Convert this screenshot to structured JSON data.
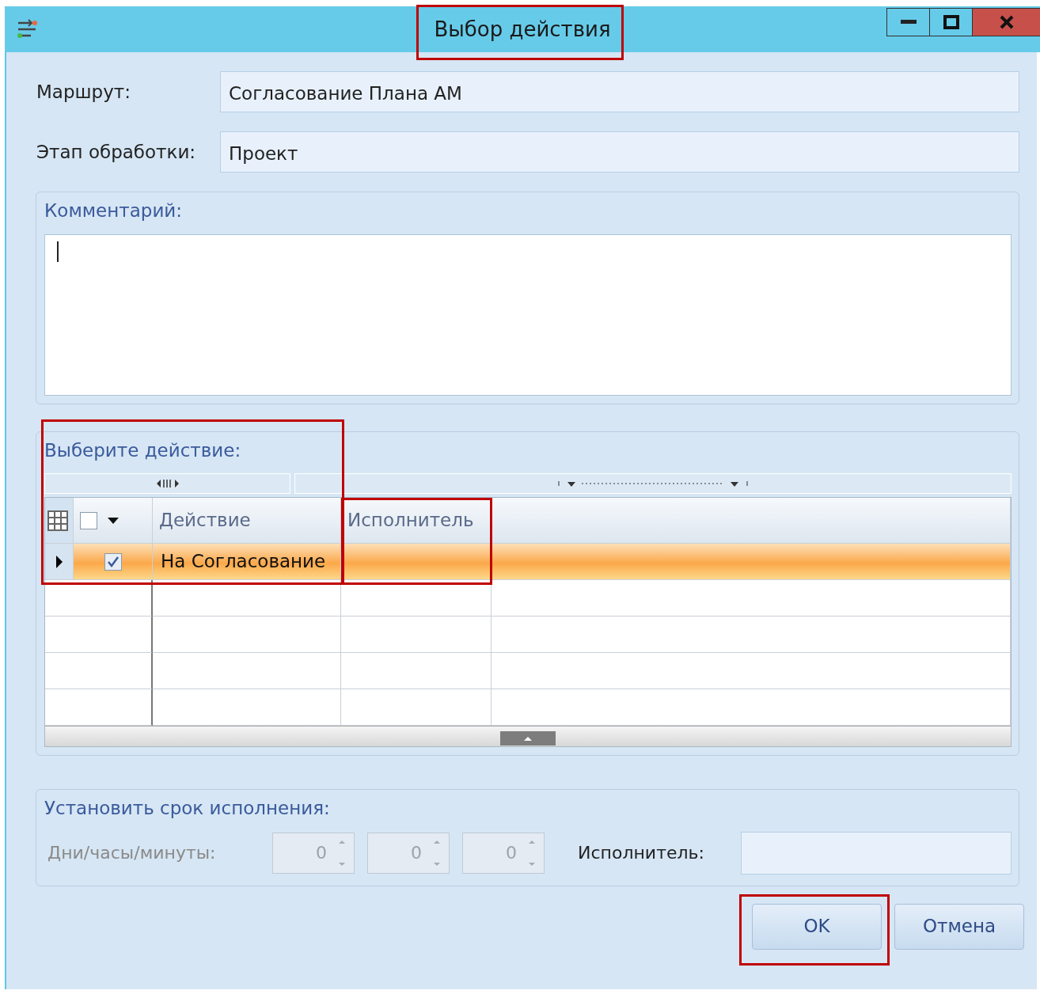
{
  "window": {
    "title": "Выбор действия",
    "title_highlighted": true
  },
  "fields": [
    {
      "label": "Маршрут:",
      "value": "Согласование Плана АМ"
    },
    {
      "label": "Этап обработки:",
      "value": "Проект"
    }
  ],
  "comment": {
    "legend": "Комментарий:"
  },
  "actions": {
    "legend": "Выберите действие:",
    "highlighted": true,
    "header_checked": false,
    "columns": [
      {
        "label": "Действие",
        "highlighted": false
      },
      {
        "label": "Исполнитель",
        "highlighted": true
      }
    ],
    "rows": [
      {
        "selected": true,
        "checked": true,
        "action": "На Согласование"
      }
    ]
  },
  "deadline": {
    "legend": "Установить срок исполнения:",
    "disabled": true,
    "label": "Дни/часы/минуты:",
    "spinners": [
      "0",
      "0",
      "0"
    ],
    "executor_label": "Исполнитель:"
  },
  "buttons": [
    {
      "label": "OK",
      "highlighted": true
    },
    {
      "label": "Отмена",
      "highlighted": false
    }
  ]
}
